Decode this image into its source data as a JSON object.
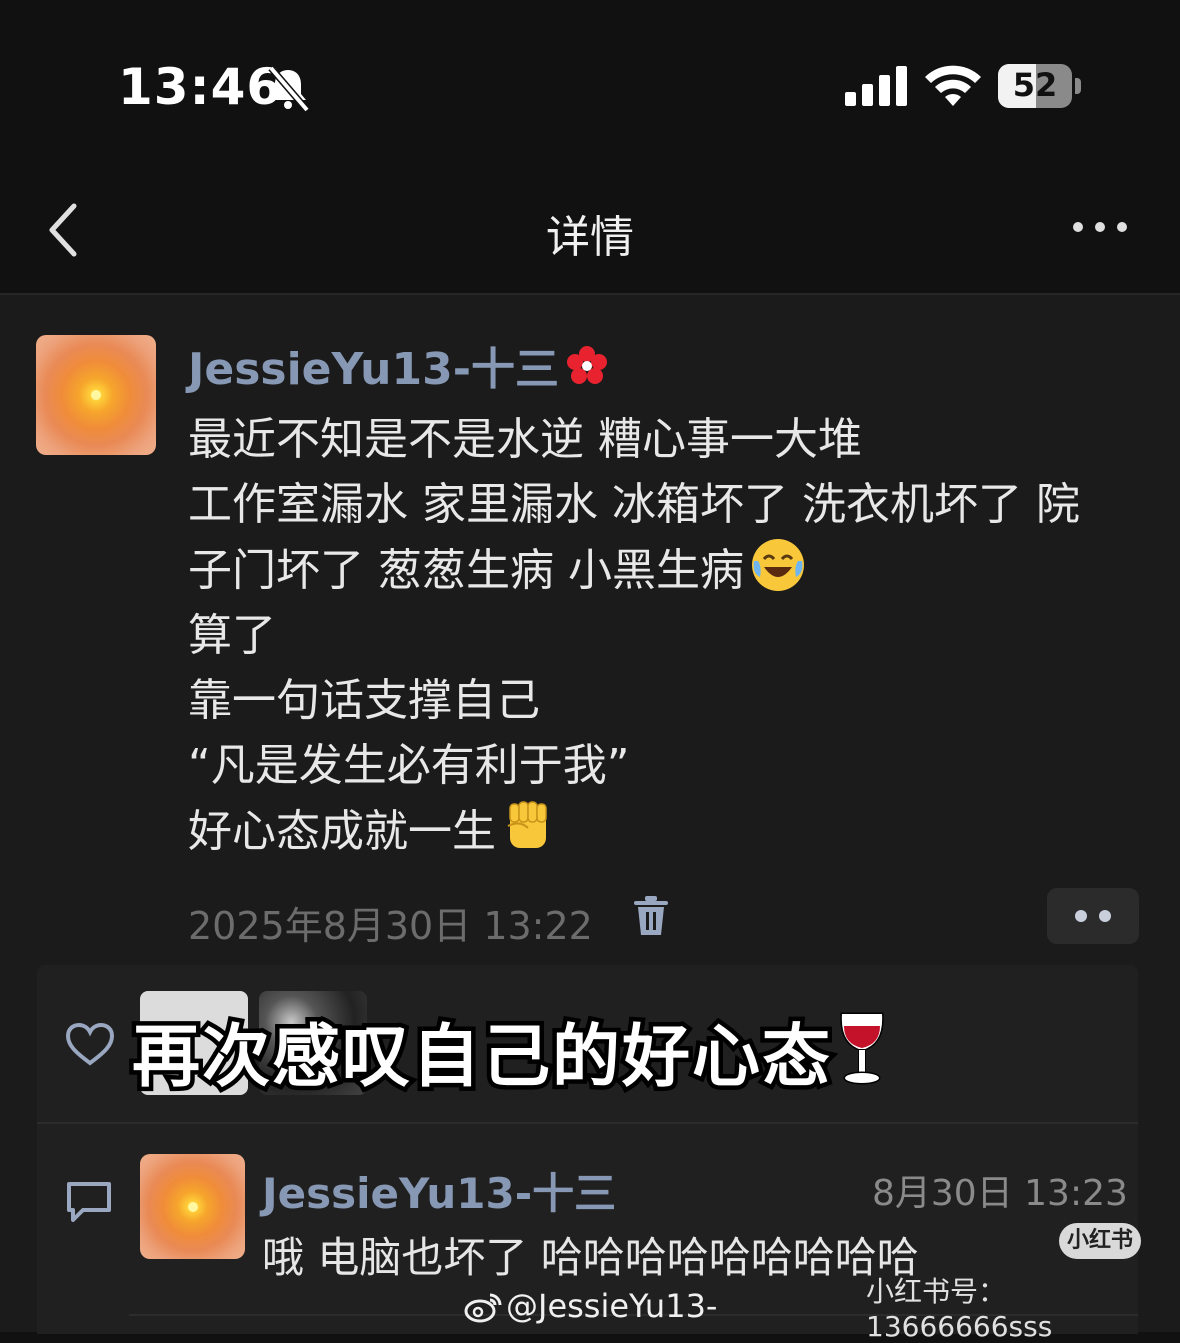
{
  "status_bar": {
    "time": "13:46",
    "battery": "52",
    "battery_level": 0.52,
    "icons": [
      "bell-slash-icon",
      "cellular-signal-icon",
      "wifi-icon",
      "battery-icon"
    ]
  },
  "nav": {
    "title": "详情",
    "back_icon": "chevron-left-icon",
    "more_icon": "ellipsis-icon"
  },
  "post": {
    "author": "JessieYu13-十三",
    "author_badge_icon": "red-flower-icon",
    "lines": [
      "最近不知是不是水逆 糟心事一大堆",
      "工作室漏水 家里漏水 冰箱坏了 洗衣机坏了 院",
      "子门坏了 葱葱生病 小黑生病",
      "算了",
      "靠一句话支撑自己",
      "“凡是发生必有利于我”",
      "好心态成就一生"
    ],
    "line3_emoji": "laughing-crying-face-icon",
    "line7_emoji": "raised-fist-icon",
    "timestamp": "2025年8月30日 13:22",
    "delete_icon": "trash-icon",
    "more_icon": "two-dots-icon"
  },
  "likes": {
    "heart_icon": "heart-outline-icon"
  },
  "overlay_caption": "再次感叹自己的好心态",
  "overlay_emoji": "wine-glass-icon",
  "comment": {
    "icon": "comment-bubble-icon",
    "author": "JessieYu13-十三",
    "time": "8月30日 13:23",
    "text": "哦 电脑也坏了 哈哈哈哈哈哈哈哈哈"
  },
  "watermarks": {
    "xhs_badge": "小红书",
    "xhs_id": "小红书号：13666666sss",
    "weibo_handle": "@JessieYu13-"
  },
  "colors": {
    "background": "#111111",
    "card": "#1b1b1b",
    "author_name": "#8798b4",
    "muted_text": "#6c6c6c"
  }
}
